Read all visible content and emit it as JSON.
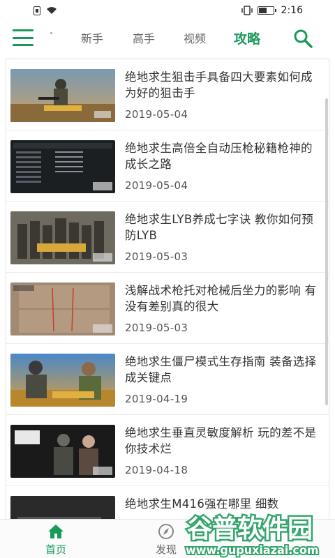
{
  "status_bar": {
    "time": "2:16",
    "battery_level": 0.6
  },
  "header": {
    "tabs": [
      {
        "label": "新手",
        "active": false
      },
      {
        "label": "高手",
        "active": false
      },
      {
        "label": "视频",
        "active": false
      },
      {
        "label": "攻略",
        "active": true
      }
    ],
    "accent_color": "#1a9a5a"
  },
  "articles": [
    {
      "title": "绝地求生狙击手具备四大要素如何成为好的狙击手",
      "date": "2019-05-04"
    },
    {
      "title": "绝地求生高倍全自动压枪秘籍枪神的成长之路",
      "date": "2019-05-04"
    },
    {
      "title": "绝地求生LYB养成七字诀 教你如何预防LYB",
      "date": "2019-05-03"
    },
    {
      "title": "浅解战术枪托对枪械后坐力的影响 有没有差别真的很大",
      "date": "2019-05-03"
    },
    {
      "title": "绝地求生僵尸模式生存指南 装备选择成关键点",
      "date": "2019-04-19"
    },
    {
      "title": "绝地求生垂直灵敏度解析 玩的差不是你技术烂",
      "date": "2019-04-18"
    },
    {
      "title": "绝地求生M416强在哪里 细数",
      "date": ""
    }
  ],
  "bottom_nav": {
    "home_label": "首页",
    "discover_label": "发现"
  },
  "watermark": {
    "name": "谷普软件园",
    "url": "www.gupuxiazai.com"
  }
}
